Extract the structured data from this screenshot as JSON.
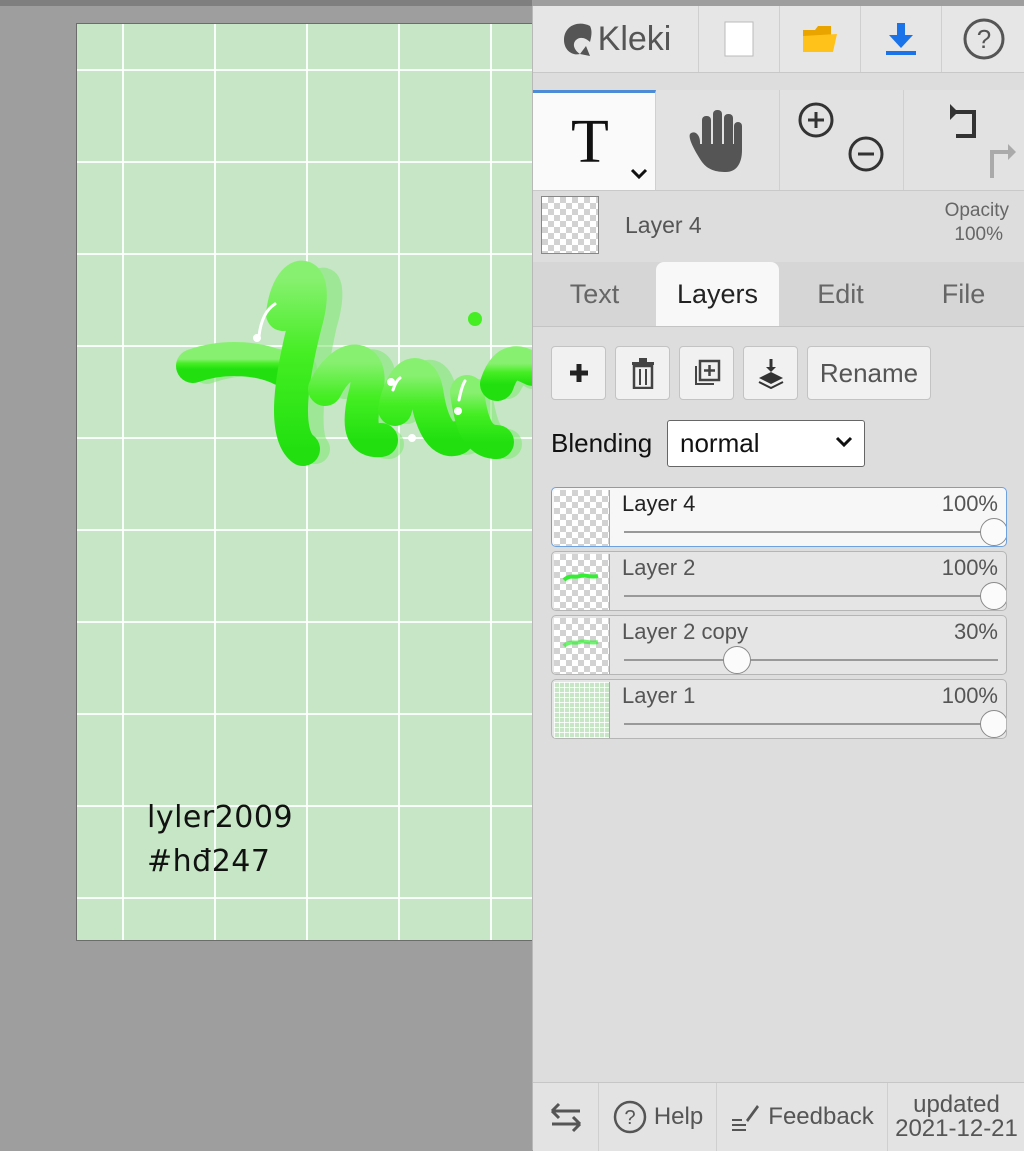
{
  "app": {
    "name": "Kleki"
  },
  "artwork": {
    "background_color": "#c6e6c6",
    "text_color": "#33ee11",
    "signature_line1": "lyler2009",
    "signature_line2": "#hđ247"
  },
  "topbar": {
    "logo_text": "Kleki",
    "icons": [
      "new-page-icon",
      "open-folder-icon",
      "download-icon",
      "help-icon"
    ]
  },
  "tools": {
    "active": "text",
    "items": [
      "text-tool",
      "hand-tool",
      "zoom-in-out",
      "undo-redo"
    ]
  },
  "current_layer": {
    "name": "Layer 4",
    "opacity_label": "Opacity",
    "opacity_value": "100%"
  },
  "tabs": [
    {
      "label": "Text",
      "active": false
    },
    {
      "label": "Layers",
      "active": true
    },
    {
      "label": "Edit",
      "active": false
    },
    {
      "label": "File",
      "active": false
    }
  ],
  "layer_actions": {
    "rename_label": "Rename",
    "icons": [
      "add-layer-icon",
      "delete-layer-icon",
      "duplicate-layer-icon",
      "merge-down-icon"
    ]
  },
  "blending": {
    "label": "Blending",
    "value": "normal"
  },
  "layers": [
    {
      "name": "Layer 4",
      "opacity_label": "100%",
      "opacity": 1.0,
      "selected": true,
      "thumb": "transparent"
    },
    {
      "name": "Layer 2",
      "opacity_label": "100%",
      "opacity": 1.0,
      "selected": false,
      "thumb": "text"
    },
    {
      "name": "Layer 2 copy",
      "opacity_label": "30%",
      "opacity": 0.3,
      "selected": false,
      "thumb": "text"
    },
    {
      "name": "Layer 1",
      "opacity_label": "100%",
      "opacity": 1.0,
      "selected": false,
      "thumb": "grid"
    }
  ],
  "bottombar": {
    "help_label": "Help",
    "feedback_label": "Feedback",
    "updated_label": "updated",
    "updated_date": "2021-12-21"
  }
}
